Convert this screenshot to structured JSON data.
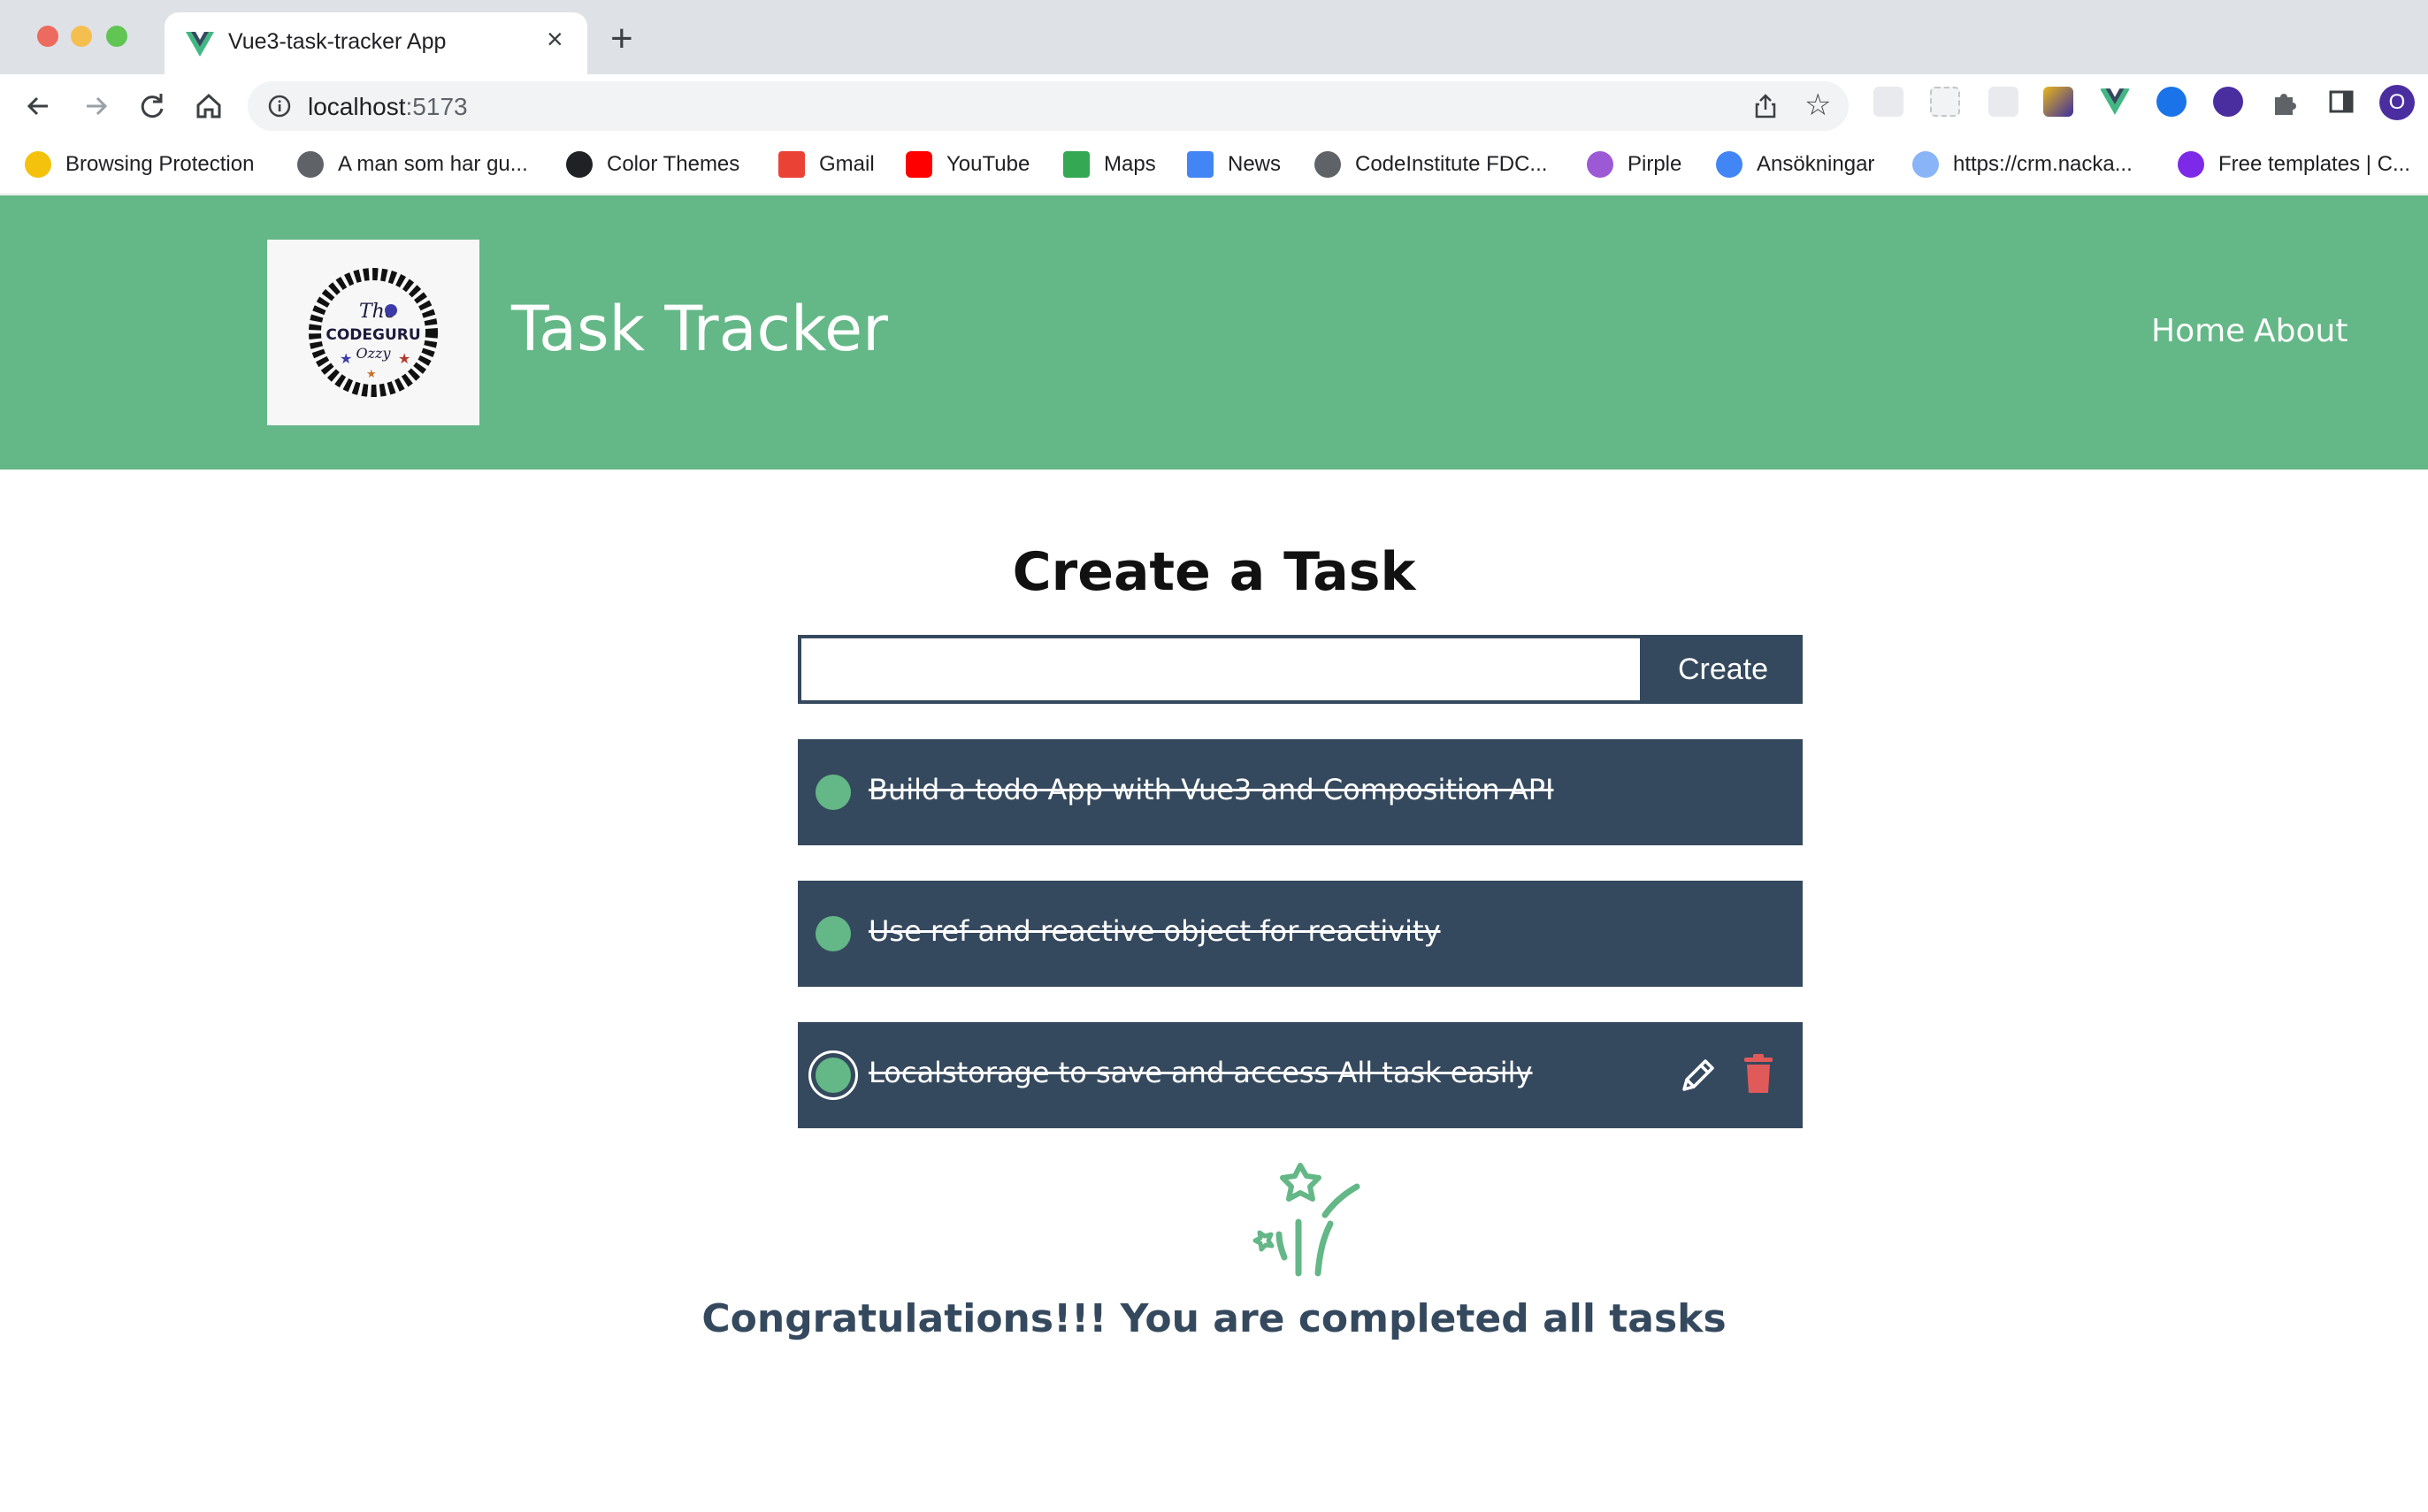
{
  "browser": {
    "tab_title": "Vue3-task-tracker App",
    "url_host": "localhost",
    "url_port": ":5173",
    "bookmarks": [
      {
        "label": "Browsing Protection",
        "icon": "shield-check-icon",
        "color": "#f4c20d"
      },
      {
        "label": "A man som har gu...",
        "icon": "globe-icon",
        "color": "#5f6368"
      },
      {
        "label": "Color Themes",
        "icon": "github-icon",
        "color": "#202124"
      },
      {
        "label": "Gmail",
        "icon": "gmail-icon",
        "color": "#ea4335"
      },
      {
        "label": "YouTube",
        "icon": "youtube-icon",
        "color": "#ff0000"
      },
      {
        "label": "Maps",
        "icon": "maps-icon",
        "color": "#34a853"
      },
      {
        "label": "News",
        "icon": "news-icon",
        "color": "#4285f4"
      },
      {
        "label": "CodeInstitute FDC...",
        "icon": "globe-icon",
        "color": "#5f6368"
      },
      {
        "label": "Pirple",
        "icon": "pirple-icon",
        "color": "#9b59d6"
      },
      {
        "label": "Ansökningar",
        "icon": "check-badge-icon",
        "color": "#4285f4"
      },
      {
        "label": "https://crm.nacka...",
        "icon": "crm-icon",
        "color": "#8ab4f8"
      },
      {
        "label": "Free templates | C...",
        "icon": "canva-icon",
        "color": "#7d2ae8"
      }
    ],
    "profile_initial": "O"
  },
  "header": {
    "logo_text": "The CODEGURU Ozzy",
    "title": "Task Tracker",
    "nav": {
      "home": "Home",
      "about": "About"
    }
  },
  "main": {
    "heading": "Create a Task",
    "input_value": "",
    "create_label": "Create",
    "tasks": [
      {
        "text": "Build a todo App with Vue3 and Composition API",
        "completed": true
      },
      {
        "text": "Use ref and reactive object for reactivity",
        "completed": true
      },
      {
        "text": "Localstorage to save and access All task easily",
        "completed": true
      }
    ],
    "congrats": "Congratulations!!! You are completed all tasks"
  },
  "colors": {
    "header_green": "#64b786",
    "task_navy": "#35495e",
    "delete_red": "#e05a5a"
  }
}
